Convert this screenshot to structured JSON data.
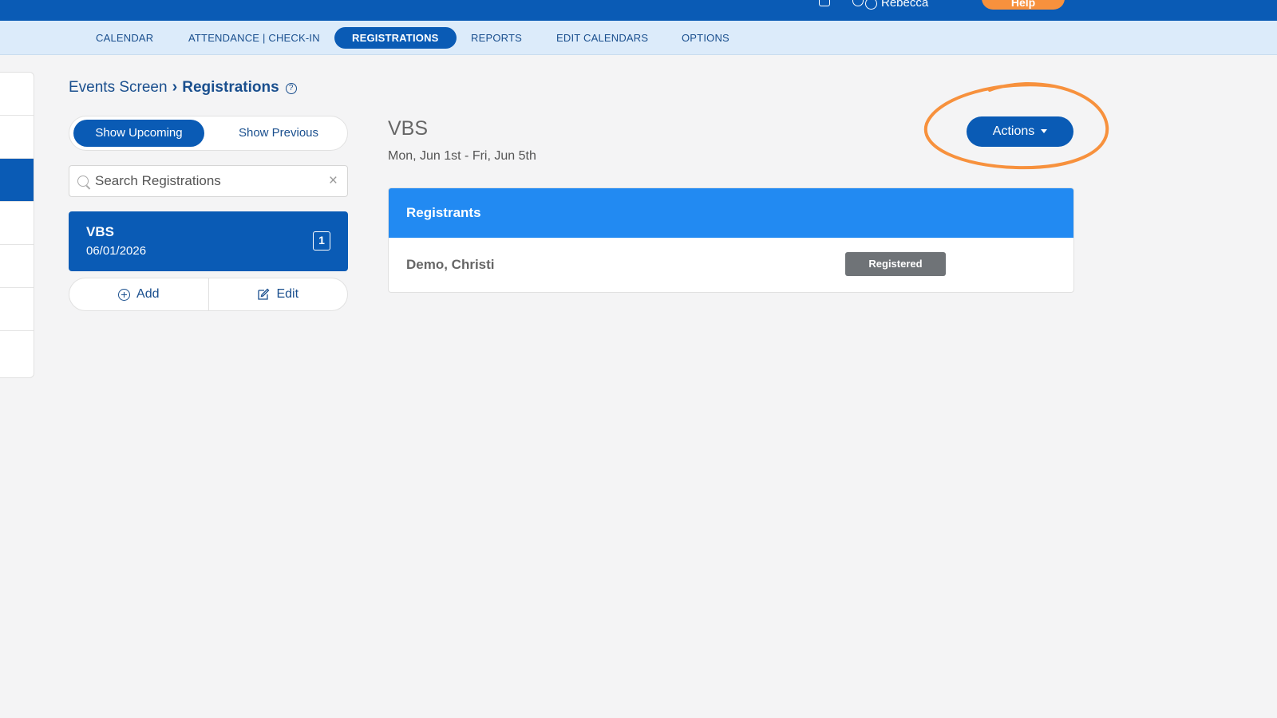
{
  "topbar": {
    "user_name": "Rebecca",
    "help_label": "Help"
  },
  "nav": {
    "items": [
      {
        "label": "CALENDAR"
      },
      {
        "label": "ATTENDANCE | CHECK-IN"
      },
      {
        "label": "REGISTRATIONS"
      },
      {
        "label": "REPORTS"
      },
      {
        "label": "EDIT CALENDARS"
      },
      {
        "label": "OPTIONS"
      }
    ],
    "active": "REGISTRATIONS"
  },
  "breadcrumb": {
    "parent": "Events Screen",
    "current": "Registrations",
    "help_glyph": "?"
  },
  "toggle": {
    "upcoming": "Show Upcoming",
    "previous": "Show Previous",
    "selected": "Show Upcoming"
  },
  "search": {
    "placeholder": "Search Registrations",
    "value": "",
    "clear_glyph": "×"
  },
  "events": [
    {
      "name": "VBS",
      "date": "06/01/2026",
      "count": "1"
    }
  ],
  "list_actions": {
    "add_label": "Add",
    "edit_label": "Edit"
  },
  "detail": {
    "title": "VBS",
    "date_range": "Mon, Jun 1st - Fri, Jun 5th",
    "actions_label": "Actions"
  },
  "registrants": {
    "header": "Registrants",
    "rows": [
      {
        "name": "Demo, Christi",
        "status": "Registered"
      }
    ]
  },
  "colors": {
    "primary": "#0a5bb5",
    "header_blue": "#228af2",
    "nav_bg": "#dcebfa",
    "highlight": "#f7913d",
    "status_gray": "#6f7377"
  },
  "icons": [
    "calendar-icon",
    "bell-icon",
    "user-icon",
    "help-icon",
    "search-icon",
    "close-icon",
    "add-circle-icon",
    "edit-icon",
    "chevron-right-icon",
    "caret-down-icon"
  ]
}
